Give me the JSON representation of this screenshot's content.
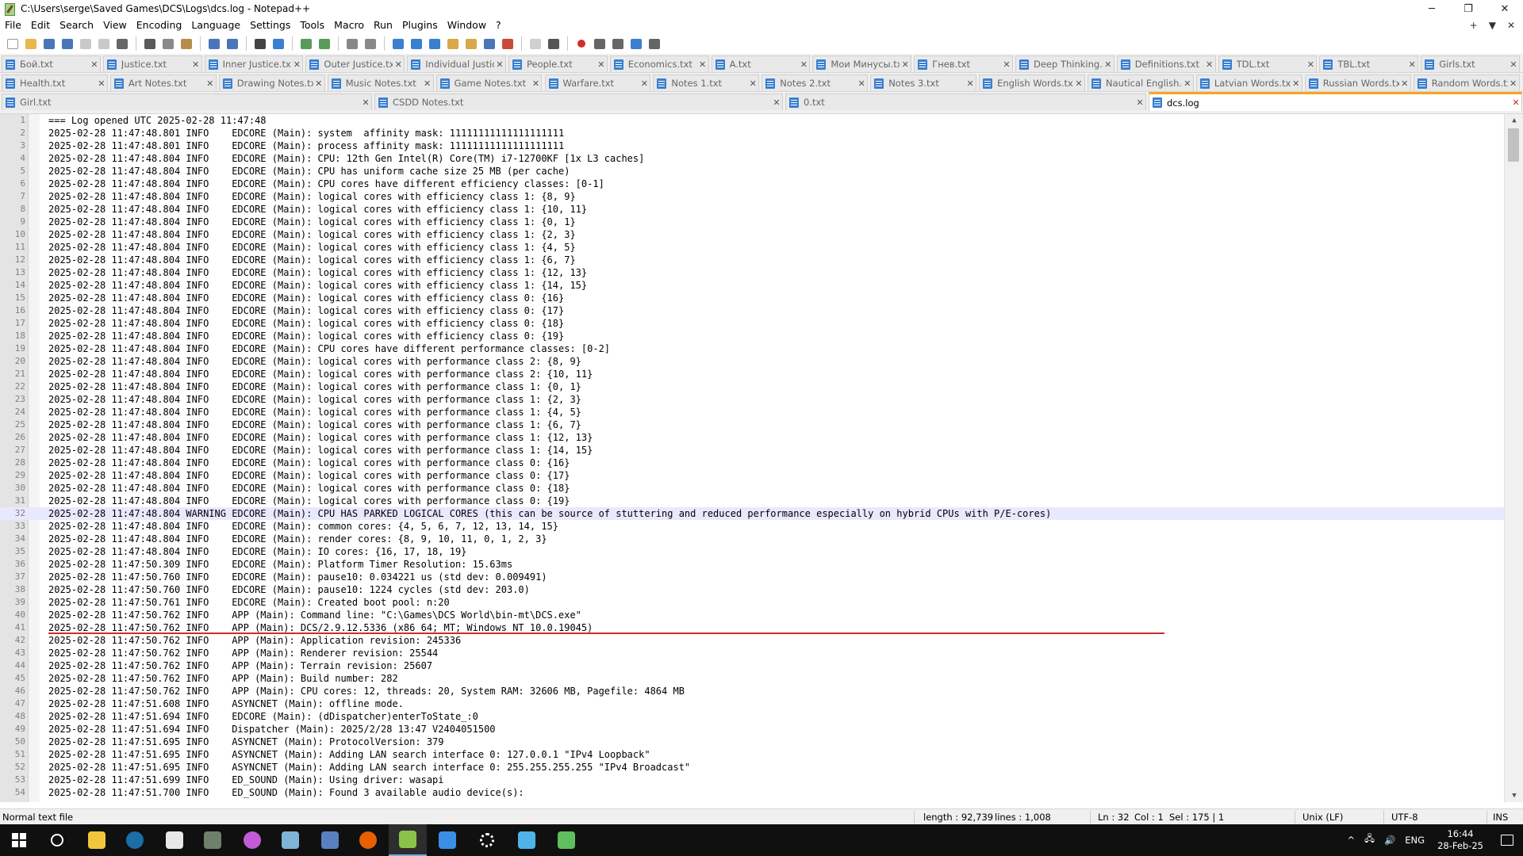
{
  "window": {
    "title": "C:\\Users\\serge\\Saved Games\\DCS\\Logs\\dcs.log - Notepad++",
    "minimize": "─",
    "maximize": "❐",
    "close": "✕"
  },
  "menu": {
    "items": [
      "File",
      "Edit",
      "Search",
      "View",
      "Encoding",
      "Language",
      "Settings",
      "Tools",
      "Macro",
      "Run",
      "Plugins",
      "Window",
      "?"
    ],
    "right": [
      "+",
      "▼",
      "✕"
    ]
  },
  "toolbar": {
    "buttons": [
      {
        "name": "new-file-icon",
        "color": "#ffffff"
      },
      {
        "name": "open-file-icon",
        "color": "#e8b84a"
      },
      {
        "name": "save-icon",
        "color": "#4a76b8"
      },
      {
        "name": "save-all-icon",
        "color": "#4a76b8"
      },
      {
        "name": "close-icon",
        "color": "#c9c9c9"
      },
      {
        "name": "close-all-icon",
        "color": "#c9c9c9"
      },
      {
        "name": "print-icon",
        "color": "#666666"
      },
      {
        "name": "cut-icon",
        "color": "#5a5a5a"
      },
      {
        "name": "copy-icon",
        "color": "#8a8a8a"
      },
      {
        "name": "paste-icon",
        "color": "#b88c4a"
      },
      {
        "name": "undo-icon",
        "color": "#4a76b8"
      },
      {
        "name": "redo-icon",
        "color": "#4a76b8"
      },
      {
        "name": "find-icon",
        "color": "#444444"
      },
      {
        "name": "replace-icon",
        "color": "#3a7fd0"
      },
      {
        "name": "zoom-in-icon",
        "color": "#5a9a5a"
      },
      {
        "name": "zoom-out-icon",
        "color": "#5a9a5a"
      },
      {
        "name": "sync-v-icon",
        "color": "#888888"
      },
      {
        "name": "sync-h-icon",
        "color": "#888888"
      },
      {
        "name": "word-wrap-icon",
        "color": "#3a7fd0"
      },
      {
        "name": "show-all-chars-icon",
        "color": "#3a7fd0"
      },
      {
        "name": "indent-guide-icon",
        "color": "#3a7fd0"
      },
      {
        "name": "udl-icon",
        "color": "#d8a84a"
      },
      {
        "name": "doc-map-icon",
        "color": "#d8a84a"
      },
      {
        "name": "function-list-icon",
        "color": "#4a76b8"
      },
      {
        "name": "folder-workspace-icon",
        "color": "#c94a3a"
      },
      {
        "name": "monitor-icon",
        "color": "#d0d0d0"
      },
      {
        "name": "monitoring-eye-icon",
        "color": "#555555"
      },
      {
        "name": "record-macro-icon",
        "color": "#d22b2b"
      },
      {
        "name": "stop-record-icon",
        "color": "#666666"
      },
      {
        "name": "play-macro-icon",
        "color": "#666666"
      },
      {
        "name": "run-macro-multiple-icon",
        "color": "#3a7fd0"
      },
      {
        "name": "save-macro-icon",
        "color": "#666666"
      }
    ]
  },
  "tabs": {
    "row1": [
      {
        "label": "Бой.txt"
      },
      {
        "label": "Justice.txt"
      },
      {
        "label": "Inner Justice.txt"
      },
      {
        "label": "Outer Justice.txt"
      },
      {
        "label": "Individual Justice.txt"
      },
      {
        "label": "People.txt"
      },
      {
        "label": "Economics.txt"
      },
      {
        "label": "A.txt"
      },
      {
        "label": "Мои Минусы.txt"
      },
      {
        "label": "Гнев.txt"
      },
      {
        "label": "Deep Thinking.txt"
      },
      {
        "label": "Definitions.txt"
      },
      {
        "label": "TDL.txt"
      },
      {
        "label": "TBL.txt"
      },
      {
        "label": "Girls.txt"
      }
    ],
    "row2": [
      {
        "label": "Health.txt"
      },
      {
        "label": "Art Notes.txt"
      },
      {
        "label": "Drawing Notes.txt"
      },
      {
        "label": "Music Notes.txt"
      },
      {
        "label": "Game Notes.txt"
      },
      {
        "label": "Warfare.txt"
      },
      {
        "label": "Notes 1.txt"
      },
      {
        "label": "Notes 2.txt"
      },
      {
        "label": "Notes 3.txt"
      },
      {
        "label": "English Words.txt"
      },
      {
        "label": "Nautical English.txt"
      },
      {
        "label": "Latvian Words.txt"
      },
      {
        "label": "Russian Words.txt"
      },
      {
        "label": "Random Words.txt"
      }
    ],
    "row3": [
      {
        "label": "Girl.txt"
      },
      {
        "label": "CSDD Notes.txt"
      },
      {
        "label": "0.txt"
      },
      {
        "label": "dcs.log"
      }
    ],
    "close_glyph": "✕"
  },
  "editor": {
    "current_line": 32,
    "lines": [
      "=== Log opened UTC 2025-02-28 11:47:48",
      "2025-02-28 11:47:48.801 INFO    EDCORE (Main): system  affinity mask: 11111111111111111111",
      "2025-02-28 11:47:48.801 INFO    EDCORE (Main): process affinity mask: 11111111111111111111",
      "2025-02-28 11:47:48.804 INFO    EDCORE (Main): CPU: 12th Gen Intel(R) Core(TM) i7-12700KF [1x L3 caches]",
      "2025-02-28 11:47:48.804 INFO    EDCORE (Main): CPU has uniform cache size 25 MB (per cache)",
      "2025-02-28 11:47:48.804 INFO    EDCORE (Main): CPU cores have different efficiency classes: [0-1]",
      "2025-02-28 11:47:48.804 INFO    EDCORE (Main): logical cores with efficiency class 1: {8, 9}",
      "2025-02-28 11:47:48.804 INFO    EDCORE (Main): logical cores with efficiency class 1: {10, 11}",
      "2025-02-28 11:47:48.804 INFO    EDCORE (Main): logical cores with efficiency class 1: {0, 1}",
      "2025-02-28 11:47:48.804 INFO    EDCORE (Main): logical cores with efficiency class 1: {2, 3}",
      "2025-02-28 11:47:48.804 INFO    EDCORE (Main): logical cores with efficiency class 1: {4, 5}",
      "2025-02-28 11:47:48.804 INFO    EDCORE (Main): logical cores with efficiency class 1: {6, 7}",
      "2025-02-28 11:47:48.804 INFO    EDCORE (Main): logical cores with efficiency class 1: {12, 13}",
      "2025-02-28 11:47:48.804 INFO    EDCORE (Main): logical cores with efficiency class 1: {14, 15}",
      "2025-02-28 11:47:48.804 INFO    EDCORE (Main): logical cores with efficiency class 0: {16}",
      "2025-02-28 11:47:48.804 INFO    EDCORE (Main): logical cores with efficiency class 0: {17}",
      "2025-02-28 11:47:48.804 INFO    EDCORE (Main): logical cores with efficiency class 0: {18}",
      "2025-02-28 11:47:48.804 INFO    EDCORE (Main): logical cores with efficiency class 0: {19}",
      "2025-02-28 11:47:48.804 INFO    EDCORE (Main): CPU cores have different performance classes: [0-2]",
      "2025-02-28 11:47:48.804 INFO    EDCORE (Main): logical cores with performance class 2: {8, 9}",
      "2025-02-28 11:47:48.804 INFO    EDCORE (Main): logical cores with performance class 2: {10, 11}",
      "2025-02-28 11:47:48.804 INFO    EDCORE (Main): logical cores with performance class 1: {0, 1}",
      "2025-02-28 11:47:48.804 INFO    EDCORE (Main): logical cores with performance class 1: {2, 3}",
      "2025-02-28 11:47:48.804 INFO    EDCORE (Main): logical cores with performance class 1: {4, 5}",
      "2025-02-28 11:47:48.804 INFO    EDCORE (Main): logical cores with performance class 1: {6, 7}",
      "2025-02-28 11:47:48.804 INFO    EDCORE (Main): logical cores with performance class 1: {12, 13}",
      "2025-02-28 11:47:48.804 INFO    EDCORE (Main): logical cores with performance class 1: {14, 15}",
      "2025-02-28 11:47:48.804 INFO    EDCORE (Main): logical cores with performance class 0: {16}",
      "2025-02-28 11:47:48.804 INFO    EDCORE (Main): logical cores with performance class 0: {17}",
      "2025-02-28 11:47:48.804 INFO    EDCORE (Main): logical cores with performance class 0: {18}",
      "2025-02-28 11:47:48.804 INFO    EDCORE (Main): logical cores with performance class 0: {19}",
      "2025-02-28 11:47:48.804 WARNING EDCORE (Main): CPU HAS PARKED LOGICAL CORES (this can be source of stuttering and reduced performance especially on hybrid CPUs with P/E-cores)",
      "2025-02-28 11:47:48.804 INFO    EDCORE (Main): common cores: {4, 5, 6, 7, 12, 13, 14, 15}",
      "2025-02-28 11:47:48.804 INFO    EDCORE (Main): render cores: {8, 9, 10, 11, 0, 1, 2, 3}",
      "2025-02-28 11:47:48.804 INFO    EDCORE (Main): IO cores: {16, 17, 18, 19}",
      "2025-02-28 11:47:50.309 INFO    EDCORE (Main): Platform Timer Resolution: 15.63ms",
      "2025-02-28 11:47:50.760 INFO    EDCORE (Main): pause10: 0.034221 us (std dev: 0.009491)",
      "2025-02-28 11:47:50.760 INFO    EDCORE (Main): pause10: 1224 cycles (std dev: 203.0)",
      "2025-02-28 11:47:50.761 INFO    EDCORE (Main): Created boot pool: n:20",
      "2025-02-28 11:47:50.762 INFO    APP (Main): Command line: \"C:\\Games\\DCS World\\bin-mt\\DCS.exe\"",
      "2025-02-28 11:47:50.762 INFO    APP (Main): DCS/2.9.12.5336 (x86_64; MT; Windows NT 10.0.19045)",
      "2025-02-28 11:47:50.762 INFO    APP (Main): Application revision: 245336",
      "2025-02-28 11:47:50.762 INFO    APP (Main): Renderer revision: 25544",
      "2025-02-28 11:47:50.762 INFO    APP (Main): Terrain revision: 25607",
      "2025-02-28 11:47:50.762 INFO    APP (Main): Build number: 282",
      "2025-02-28 11:47:50.762 INFO    APP (Main): CPU cores: 12, threads: 20, System RAM: 32606 MB, Pagefile: 4864 MB",
      "2025-02-28 11:47:51.608 INFO    ASYNCNET (Main): offline mode.",
      "2025-02-28 11:47:51.694 INFO    EDCORE (Main): (dDispatcher)enterToState_:0",
      "2025-02-28 11:47:51.694 INFO    Dispatcher (Main): 2025/2/28 13:47 V2404051500",
      "2025-02-28 11:47:51.695 INFO    ASYNCNET (Main): ProtocolVersion: 379",
      "2025-02-28 11:47:51.695 INFO    ASYNCNET (Main): Adding LAN search interface 0: 127.0.0.1 \"IPv4 Loopback\"",
      "2025-02-28 11:47:51.695 INFO    ASYNCNET (Main): Adding LAN search interface 0: 255.255.255.255 \"IPv4 Broadcast\"",
      "2025-02-28 11:47:51.699 INFO    ED_SOUND (Main): Using driver: wasapi",
      "2025-02-28 11:47:51.700 INFO    ED_SOUND (Main): Found 3 available audio device(s):"
    ]
  },
  "status": {
    "file_type": "Normal text file",
    "length": "length : 92,739",
    "lines": "lines : 1,008",
    "ln": "Ln : 32",
    "col": "Col : 1",
    "sel": "Sel : 175 | 1",
    "eol": "Unix (LF)",
    "encoding": "UTF-8",
    "mode": "INS"
  },
  "taskbar": {
    "apps": [
      {
        "name": "windows-start-icon",
        "color": "#ffffff"
      },
      {
        "name": "search-icon",
        "color": "#ffffff"
      },
      {
        "name": "file-explorer-icon",
        "color": "#f2c53d"
      },
      {
        "name": "steam-icon",
        "color": "#1b6ea8"
      },
      {
        "name": "app-mask-icon",
        "color": "#e8e8e8"
      },
      {
        "name": "app-jet-icon",
        "color": "#6e7f6a"
      },
      {
        "name": "app-colorwheel-icon",
        "color": "#c25bd6"
      },
      {
        "name": "app-bird-icon",
        "color": "#7fb3d8"
      },
      {
        "name": "app-document-icon",
        "color": "#5a7fc0"
      },
      {
        "name": "firefox-icon",
        "color": "#e66000"
      },
      {
        "name": "notepadpp-icon",
        "color": "#8bc34a"
      },
      {
        "name": "app-gear-blue-icon",
        "color": "#3a8ee6"
      },
      {
        "name": "settings-icon",
        "color": "#ffffff"
      },
      {
        "name": "app-window-icon",
        "color": "#4fb3e8"
      },
      {
        "name": "app-green-icon",
        "color": "#5fbf5f"
      }
    ],
    "active_index": 10,
    "tray": {
      "chevron": "^",
      "network": "🖧",
      "volume": "🔊",
      "lang": "ENG",
      "time": "16:44",
      "date": "28-Feb-25"
    }
  }
}
